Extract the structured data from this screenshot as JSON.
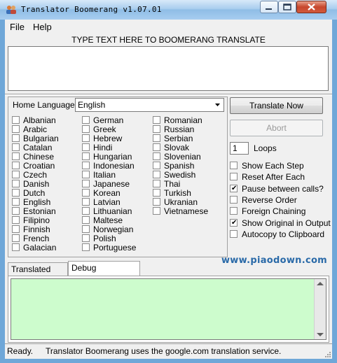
{
  "window": {
    "title": "Translator Boomerang v1.07.01"
  },
  "menu": {
    "file": "File",
    "help": "Help"
  },
  "prompt": "TYPE TEXT HERE TO BOOMERANG TRANSLATE",
  "input": {
    "value": ""
  },
  "home_language": {
    "label": "Home Language:",
    "selected": "English"
  },
  "languages": [
    [
      "Albanian",
      "Arabic",
      "Bulgarian",
      "Catalan",
      "Chinese",
      "Croatian",
      "Czech",
      "Danish",
      "Dutch",
      "English",
      "Estonian",
      "Filipino",
      "Finnish",
      "French",
      "Galacian"
    ],
    [
      "German",
      "Greek",
      "Hebrew",
      "Hindi",
      "Hungarian",
      "Indonesian",
      "Italian",
      "Japanese",
      "Korean",
      "Latvian",
      "Lithuanian",
      "Maltese",
      "Norwegian",
      "Polish",
      "Portuguese"
    ],
    [
      "Romanian",
      "Russian",
      "Serbian",
      "Slovak",
      "Slovenian",
      "Spanish",
      "Swedish",
      "Thai",
      "Turkish",
      "Ukranian",
      "Vietnamese"
    ]
  ],
  "buttons": {
    "translate": "Translate Now",
    "abort": "Abort"
  },
  "loops": {
    "value": "1",
    "label": "Loops"
  },
  "options": [
    {
      "label": "Show Each Step",
      "checked": false
    },
    {
      "label": "Reset After Each",
      "checked": false
    },
    {
      "label": "Pause between calls?",
      "checked": true
    },
    {
      "label": "Reverse Order",
      "checked": false
    },
    {
      "label": "Foreign Chaining",
      "checked": false
    },
    {
      "label": "Show Original in Output",
      "checked": true
    },
    {
      "label": "Autocopy to Clipboard",
      "checked": false
    }
  ],
  "watermark": "www.piaodown.com",
  "tabs": {
    "translated": "Translated Text",
    "debug": "Debug Information",
    "active": "debug"
  },
  "status": {
    "state": "Ready.",
    "message": "Translator Boomerang uses the google.com translation service."
  },
  "colors": {
    "titlebar": "#a9cdee",
    "debug_bg": "#cdfccd",
    "watermark": "#2a6aa8"
  }
}
